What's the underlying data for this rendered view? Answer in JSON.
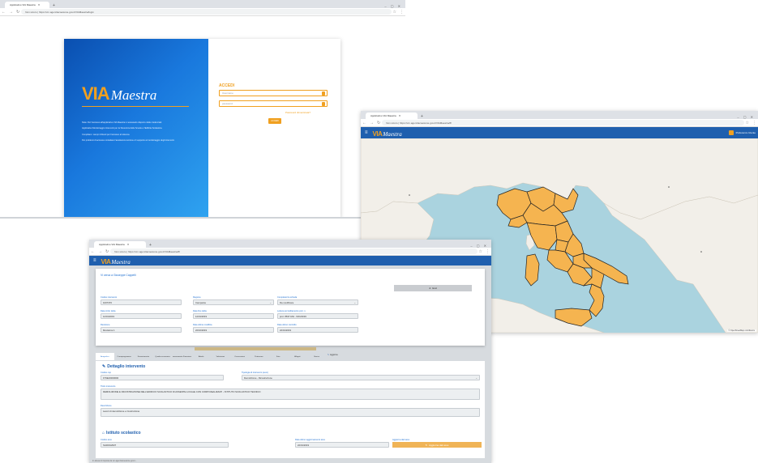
{
  "colors": {
    "brand_blue": "#1f5fae",
    "brand_orange": "#f0a020",
    "sea": "#aad3df",
    "land": "#f2efe9",
    "region_fill": "#f5b450"
  },
  "login_window": {
    "tab_title": "Applicativo VIA Maestra",
    "url": "Non sicuro | https://vm.agenziacoesione.gov.it/VIAMaestra/login",
    "logo_via": "VIA",
    "logo_maestra": "Maestra",
    "info_paragraphs": [
      "Nota: Per l'accesso all'applicativo VIA Maestra è necessario disporre delle credenziali.",
      "Applicativo Monitoraggio Interventi per la Sicurezza delle Scuole e l'Edilizia Scolastica.",
      "Compilare i campi richiesti per l'accesso al sistema.",
      "Per problemi di accesso contattare l'assistenza tecnica e il supporto al monitoraggio degli interventi."
    ],
    "access_title": "ACCEDI",
    "username_placeholder": "Username",
    "password_placeholder": "password",
    "forgot_link": "Password dimenticata?",
    "login_button": "ACCEDI"
  },
  "map_window": {
    "tab_title": "Applicativo VIA Maestra",
    "url": "Non sicuro | https://vm.agenziacoesione.gov.it/VIAMaestra/#/",
    "header_via": "VIA",
    "header_maestra": "Maestra",
    "user_label": "Preferenze Utente",
    "attribution": "© OpenStreetMap contributors",
    "fab_icon": "search-icon"
  },
  "form_window": {
    "tab_title": "Applicativo VIA Maestra",
    "url": "Non sicuro | https://vm.agenziacoesione.gov.it/VIAMaestra/#/",
    "dialog_title": "Vi cerca a Giuseppe Cappelli",
    "dialog_button": "Esci",
    "fields_row1": [
      {
        "label": "Codice intervento",
        "value": "1007376"
      },
      {
        "label": "Regione",
        "value": "Campania"
      },
      {
        "label": "Completezza scheda",
        "value": "Da modificare"
      }
    ],
    "fields_row2": [
      {
        "label": "Data inizio delta",
        "value": "12/01/2019"
      },
      {
        "label": "Data fine delta",
        "value": "12/01/2019"
      },
      {
        "label": "Lettera accreditamento prot. n.",
        "value": "prot. 8637-MH - 9/01/2019"
      }
    ],
    "fields_row3": [
      {
        "label": "Revisione",
        "value": "Revisione 1"
      },
      {
        "label": "Data ultima modifica",
        "value": "22/10/2019"
      },
      {
        "label": "Data ultimo controllo",
        "value": "22/01/2019"
      }
    ],
    "tabs": [
      "Anagrafica",
      "Cronoprogramma",
      "Finanziamento",
      "Quadro economico",
      "Avanzamento Finanziario",
      "Attività",
      "Valutazioni",
      "Osservazioni",
      "Pertinenze",
      "Foto",
      "Allegati",
      "Storico"
    ],
    "strip_button": "Aggiorna",
    "section1_title": "Dettaglio intervento",
    "codice_cup_label": "Codice cup",
    "codice_cup_value": "F79E16000000",
    "tipologia_label": "Tipologia di intervento (euro)",
    "tipologia_value": "Demolizione - Ricostruzione",
    "titolo_label": "Titolo intervento",
    "titolo_value": "DEMOLIZIONE E RICOSTRUZIONE DELL'EDIFICIO SCOLASTICO DI ASSENTE LOCALE CON CORPI REALIZZATI - ISTITUTO SCOLASTICO TECNICO",
    "descrizione_label": "Descrizione",
    "descrizione_value": "Lavori di demolizione e ricostruzione",
    "section2_title": "Istituto scolastico",
    "codice_ares_label": "Codice ares",
    "codice_ares_value": "SA00012937",
    "data_agg_label": "Data ultimo aggiornamento ares",
    "data_agg_value": "22/01/2019",
    "agg_btn_label": "Aggiorna dati ares",
    "agg_button": "Aggiorna dati ares",
    "footer": "In attesa di risposta da vm.agenziacoesione.gov.it..."
  }
}
